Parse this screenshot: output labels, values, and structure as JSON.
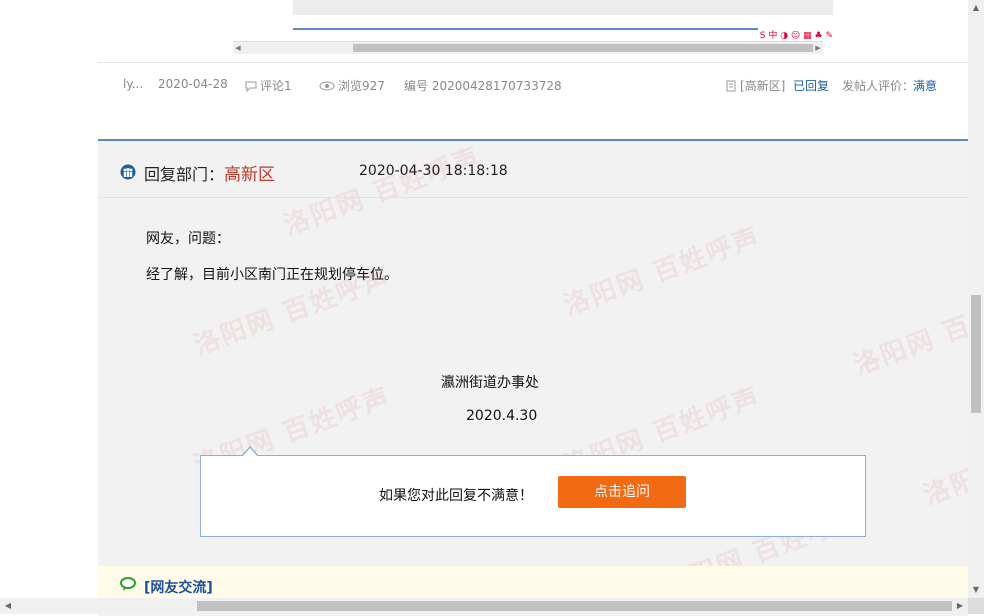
{
  "meta": {
    "author": "ly...",
    "date": "2020-04-28",
    "comments": "评论1",
    "views": "浏览927",
    "serial": "编号 20200428170733728",
    "district": "[高新区]",
    "status": "已回复",
    "rating_label": "发帖人评价：",
    "rating_value": "满意"
  },
  "reply": {
    "dept_label": "回复部门：",
    "dept_name": "高新区",
    "time": "2020-04-30 18:18:18",
    "greeting": "网友，问题：",
    "body": "经了解，目前小区南门正在规划停车位。",
    "signature_org": "瀛洲街道办事处",
    "signature_date": "2020.4.30"
  },
  "tip": {
    "text": "如果您对此回复不满意！",
    "button": "点击追问"
  },
  "discuss": {
    "label": "[网友交流]"
  },
  "watermark": "洛阳网 百姓呼声",
  "colors": {
    "accent_blue": "#1c5fa8",
    "dept_red": "#c0392b",
    "button_orange": "#f26a12",
    "panel_bg": "#f2f2f2"
  }
}
